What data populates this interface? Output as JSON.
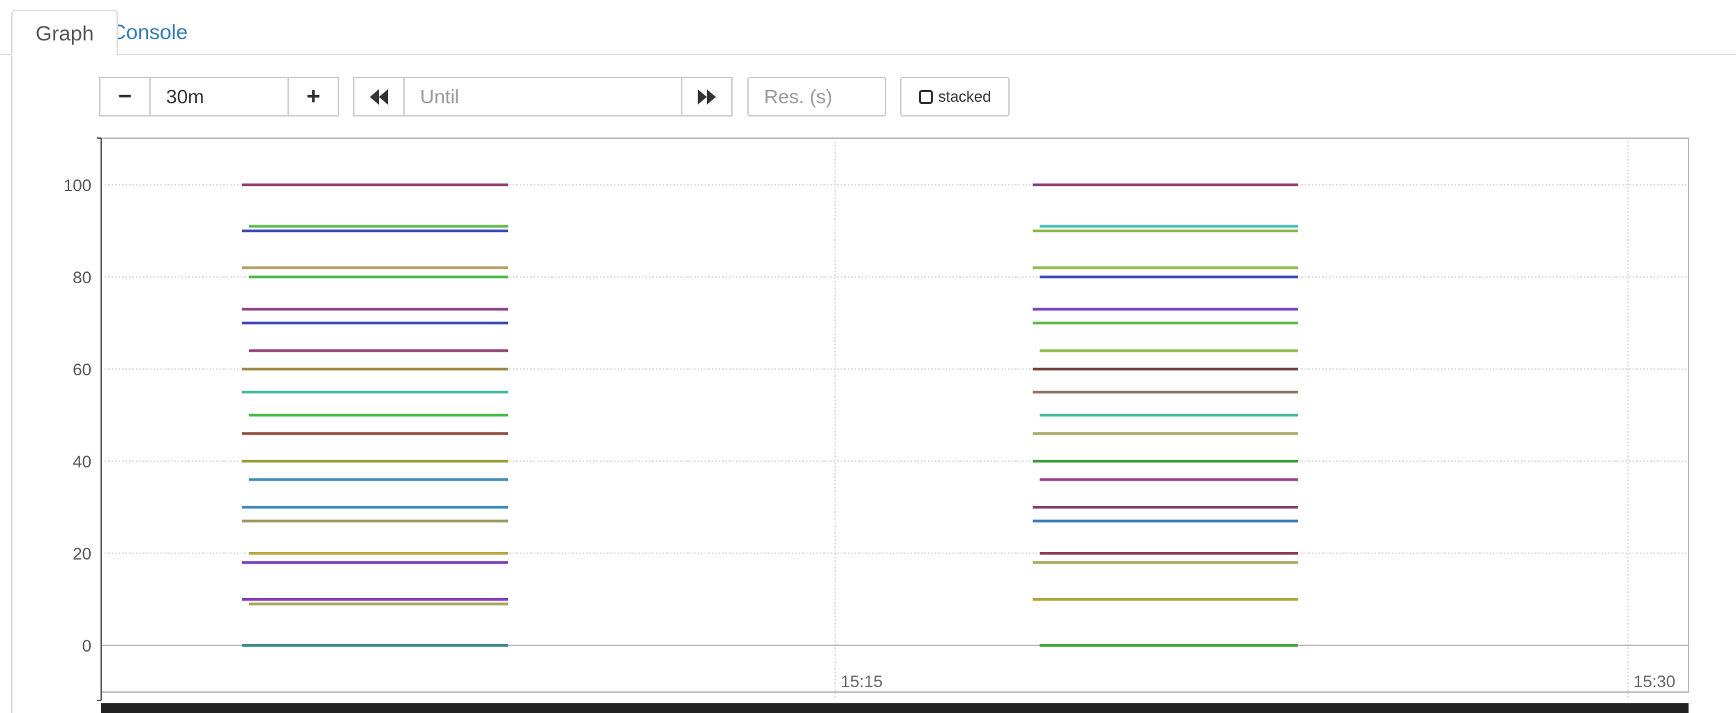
{
  "tabs": [
    {
      "label": "Graph",
      "active": true
    },
    {
      "label": "Console",
      "active": false
    }
  ],
  "controls": {
    "range_decrease_label": "−",
    "range_value": "30m",
    "range_increase_label": "+",
    "until_placeholder": "Until",
    "resolution_placeholder": "Res. (s)",
    "stacked_label": "stacked",
    "icons": {
      "back": "fast-backward-icon",
      "forward": "fast-forward-icon",
      "stacked": "checkbox-icon"
    }
  },
  "chart_data": {
    "type": "line",
    "xlabel": "",
    "ylabel": "",
    "x_ticks": [
      "15:15",
      "15:30"
    ],
    "y_ticks": [
      0,
      20,
      40,
      60,
      80,
      100
    ],
    "ylim": [
      -10,
      110
    ],
    "grid": true,
    "segments": [
      {
        "y_values": [
          100,
          91,
          90,
          82,
          80,
          73,
          70,
          64,
          60,
          55,
          50,
          46,
          40,
          36,
          30,
          27,
          20,
          18,
          10,
          9,
          0
        ],
        "colors": [
          "#8c3f6e",
          "#5fb94a",
          "#3a4ab8",
          "#b79a61",
          "#47b947",
          "#8a3f8c",
          "#3a4ab8",
          "#8c3f6e",
          "#9a8a47",
          "#47b99a",
          "#47b947",
          "#8c4a3f",
          "#9a9a3f",
          "#3f8cb9",
          "#3f8cb9",
          "#9a9a61",
          "#b9a93f",
          "#7a3fb9",
          "#8a3fb9",
          "#a9a961",
          "#3f8c8c"
        ]
      },
      {
        "y_values": [
          100,
          91,
          90,
          82,
          80,
          73,
          70,
          64,
          60,
          55,
          50,
          46,
          40,
          36,
          30,
          27,
          20,
          18,
          10,
          0
        ],
        "colors": [
          "#8c3f6e",
          "#47b9b9",
          "#8cb947",
          "#8cb947",
          "#3a4ab8",
          "#7a3fb9",
          "#5fb94a",
          "#8cb947",
          "#7a3f3f",
          "#8c7a5f",
          "#47b99a",
          "#a9a961",
          "#3f9a3f",
          "#9a3f8c",
          "#8c3f6e",
          "#3f7ab9",
          "#8c3f5f",
          "#a9a961",
          "#a9a93f",
          "#47a93f"
        ]
      }
    ]
  }
}
